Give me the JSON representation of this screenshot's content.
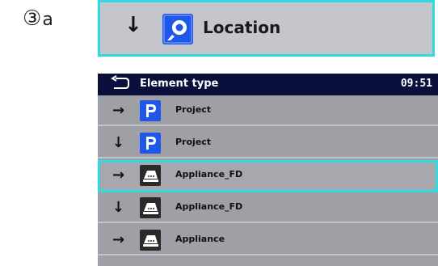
{
  "step_label": {
    "number": "③",
    "suffix": "a"
  },
  "location_zoom": {
    "arrow": "↓",
    "label": "Location",
    "icon": "location-icon"
  },
  "screen": {
    "header": {
      "title": "Element type",
      "time": "09:51",
      "back_icon": "back-arrow-icon"
    },
    "rows": [
      {
        "arrow": "→",
        "icon": "project-icon",
        "label": "Project"
      },
      {
        "arrow": "↓",
        "icon": "project-icon",
        "label": "Project"
      },
      {
        "arrow": "→",
        "icon": "appliance-icon",
        "label": "Appliance_FD",
        "selected": true
      },
      {
        "arrow": "↓",
        "icon": "appliance-icon",
        "label": "Appliance_FD"
      },
      {
        "arrow": "→",
        "icon": "appliance-icon",
        "label": "Appliance"
      }
    ]
  },
  "colors": {
    "accent": "#30d8e0",
    "header_bg": "#0a0f3c",
    "row_bg": "#9ea0a6",
    "icon_blue": "#1f57e8"
  }
}
